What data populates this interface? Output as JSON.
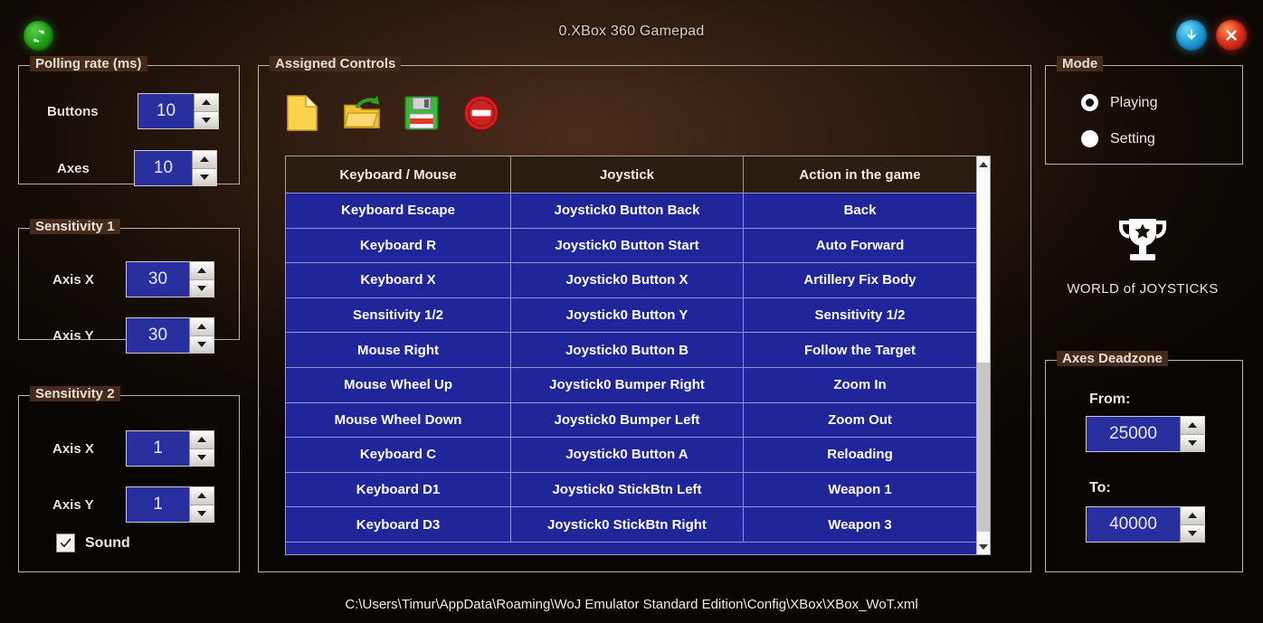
{
  "window": {
    "title": "0.XBox 360 Gamepad",
    "refresh_icon": "refresh-icon",
    "minimize_icon": "minimize-down-arrow-icon",
    "close_icon": "close-x-icon"
  },
  "polling_rate": {
    "legend": "Polling rate (ms)",
    "fields": [
      {
        "label": "Buttons",
        "value": "10"
      },
      {
        "label": "Axes",
        "value": "10"
      }
    ]
  },
  "sensitivity_1": {
    "legend": "Sensitivity 1",
    "fields": [
      {
        "label": "Axis X",
        "value": "30"
      },
      {
        "label": "Axis Y",
        "value": "30"
      }
    ]
  },
  "sensitivity_2": {
    "legend": "Sensitivity 2",
    "fields": [
      {
        "label": "Axis X",
        "value": "1"
      },
      {
        "label": "Axis Y",
        "value": "1"
      }
    ],
    "sound": {
      "label": "Sound",
      "checked": true
    }
  },
  "assigned_controls": {
    "legend": "Assigned Controls",
    "toolbar": [
      {
        "name": "new-file-icon",
        "tooltip": "New"
      },
      {
        "name": "open-folder-icon",
        "tooltip": "Open"
      },
      {
        "name": "save-floppy-icon",
        "tooltip": "Save"
      },
      {
        "name": "delete-minus-icon",
        "tooltip": "Delete"
      }
    ],
    "columns": [
      "Keyboard / Mouse",
      "Joystick",
      "Action in the game"
    ],
    "rows": [
      [
        "Keyboard Escape",
        "Joystick0 Button Back",
        "Back"
      ],
      [
        "Keyboard R",
        "Joystick0 Button Start",
        "Auto Forward"
      ],
      [
        "Keyboard X",
        "Joystick0 Button X",
        "Artillery Fix Body"
      ],
      [
        "Sensitivity 1/2",
        "Joystick0 Button Y",
        "Sensitivity 1/2"
      ],
      [
        "Mouse Right",
        "Joystick0 Button B",
        "Follow the Target"
      ],
      [
        "Mouse Wheel Up",
        "Joystick0 Bumper Right",
        "Zoom In"
      ],
      [
        "Mouse Wheel Down",
        "Joystick0 Bumper Left",
        "Zoom Out"
      ],
      [
        "Keyboard C",
        "Joystick0 Button A",
        "Reloading"
      ],
      [
        "Keyboard D1",
        "Joystick0 StickBtn Left",
        "Weapon 1"
      ],
      [
        "Keyboard D3",
        "Joystick0 StickBtn Right",
        "Weapon 3"
      ]
    ]
  },
  "mode": {
    "legend": "Mode",
    "options": [
      {
        "label": "Playing",
        "selected": true
      },
      {
        "label": "Setting",
        "selected": false
      }
    ]
  },
  "brand": {
    "icon": "trophy-icon",
    "text": "WORLD of JOYSTICKS"
  },
  "axes_deadzone": {
    "legend": "Axes Deadzone",
    "fields": [
      {
        "label": "From:",
        "value": "25000"
      },
      {
        "label": "To:",
        "value": "40000"
      }
    ]
  },
  "footer": {
    "path": "C:\\Users\\Timur\\AppData\\Roaming\\WoJ Emulator Standard Edition\\Config\\XBox\\XBox_WoT.xml"
  },
  "colors": {
    "accent_blue": "#21259A",
    "field_blue": "#2A2FA0",
    "background": "#2E1B10",
    "border": "#B8B2AA"
  }
}
